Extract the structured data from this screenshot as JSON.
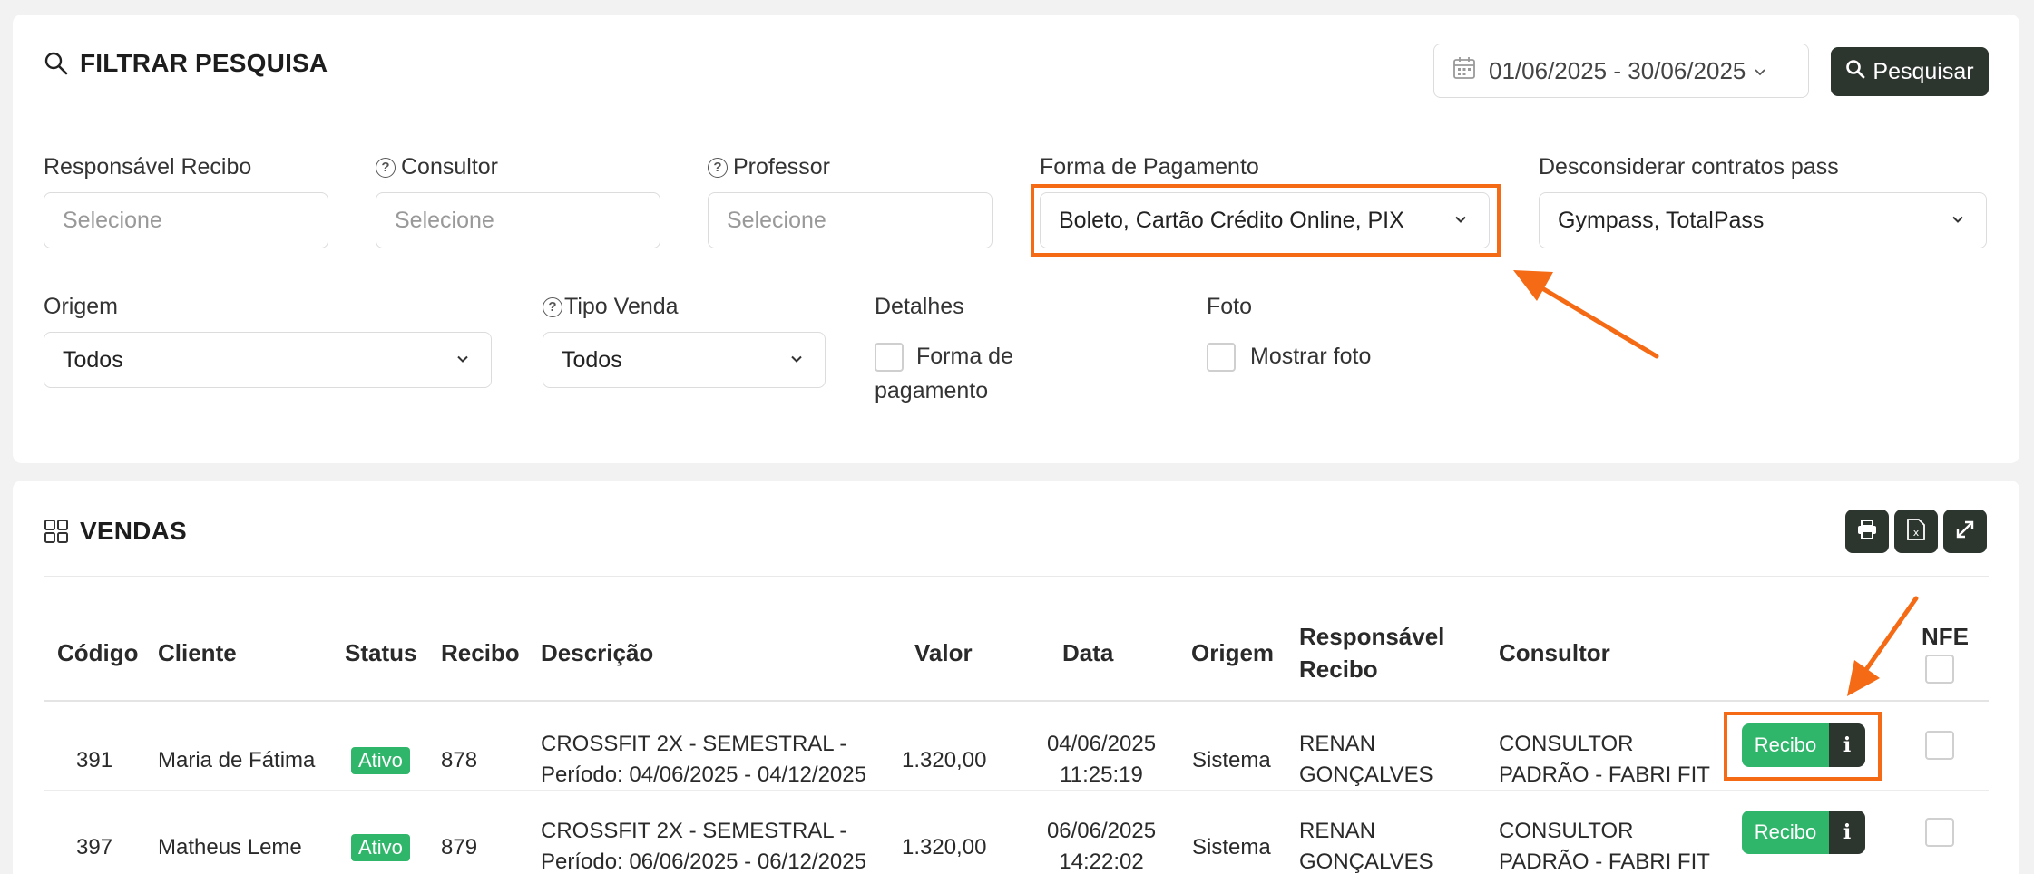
{
  "filter": {
    "title": "FILTRAR PESQUISA",
    "date_range": "01/06/2025 - 30/06/2025",
    "search_label": "Pesquisar",
    "fields": {
      "responsavel_label": "Responsável Recibo",
      "responsavel_placeholder": "Selecione",
      "consultor_label": "Consultor",
      "consultor_placeholder": "Selecione",
      "professor_label": "Professor",
      "professor_placeholder": "Selecione",
      "forma_label": "Forma de Pagamento",
      "forma_value": "Boleto, Cartão Crédito Online, PIX",
      "desconsiderar_label": "Desconsiderar contratos pass",
      "desconsiderar_value": "Gympass, TotalPass",
      "origem_label": "Origem",
      "origem_value": "Todos",
      "tipo_venda_label": "Tipo Venda",
      "tipo_venda_value": "Todos",
      "detalhes_label": "Detalhes",
      "detalhes_check_line1": "Forma de",
      "detalhes_check_line2": "pagamento",
      "foto_label": "Foto",
      "foto_check": "Mostrar foto"
    }
  },
  "sales": {
    "title": "VENDAS",
    "columns": {
      "codigo": "Código",
      "cliente": "Cliente",
      "status": "Status",
      "recibo": "Recibo",
      "descricao": "Descrição",
      "valor": "Valor",
      "data": "Data",
      "origem": "Origem",
      "responsavel_line1": "Responsável",
      "responsavel_line2": "Recibo",
      "consultor": "Consultor",
      "nfe": "NFE"
    },
    "rows": [
      {
        "codigo": "391",
        "cliente": "Maria de Fátima",
        "status": "Ativo",
        "recibo": "878",
        "descricao_line1": "CROSSFIT 2X - SEMESTRAL -",
        "descricao_line2": "Período: 04/06/2025 - 04/12/2025",
        "valor": "1.320,00",
        "data_line1": "04/06/2025",
        "data_line2": "11:25:19",
        "origem": "Sistema",
        "responsavel_line1": "RENAN",
        "responsavel_line2": "GONÇALVES",
        "consultor_line1": "CONSULTOR",
        "consultor_line2": "PADRÃO - FABRI FIT",
        "recibo_btn": "Recibo",
        "info_btn": "i"
      },
      {
        "codigo": "397",
        "cliente": "Matheus Leme",
        "status": "Ativo",
        "recibo": "879",
        "descricao_line1": "CROSSFIT 2X - SEMESTRAL -",
        "descricao_line2": "Período: 06/06/2025 - 06/12/2025",
        "valor": "1.320,00",
        "data_line1": "06/06/2025",
        "data_line2": "14:22:02",
        "origem": "Sistema",
        "responsavel_line1": "RENAN",
        "responsavel_line2": "GONÇALVES",
        "consultor_line1": "CONSULTOR",
        "consultor_line2": "PADRÃO - FABRI FIT",
        "recibo_btn": "Recibo",
        "info_btn": "i"
      }
    ]
  },
  "colors": {
    "accent_dark": "#2d352f",
    "success": "#2fb66a",
    "highlight": "#f56a14"
  },
  "icons": [
    "search-icon",
    "calendar-icon",
    "chevron-down-icon",
    "help-icon",
    "grid-icon",
    "print-icon",
    "excel-icon",
    "expand-icon",
    "info-icon"
  ]
}
